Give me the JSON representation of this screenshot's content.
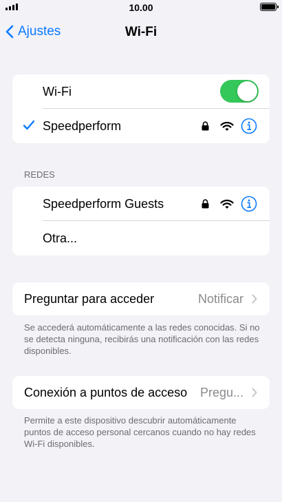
{
  "status_bar": {
    "time": "10.00"
  },
  "nav": {
    "back_label": "Ajustes",
    "title": "Wi-Fi"
  },
  "wifi_group": {
    "toggle_label": "Wi-Fi",
    "toggle_on": true,
    "connected_network": "Speedperform"
  },
  "networks": {
    "header": "REDES",
    "items": [
      {
        "label": "Speedperform Guests"
      },
      {
        "label": "Otra..."
      }
    ]
  },
  "ask_to_join": {
    "label": "Preguntar para acceder",
    "value": "Notificar",
    "footnote": "Se accederá automáticamente a las redes conocidas. Si no se detecta ninguna, recibirás una notificación con las redes disponibles."
  },
  "hotspot": {
    "label": "Conexión a puntos de acceso",
    "value": "Pregu...",
    "footnote": "Permite a este dispositivo descubrir automáticamente puntos de acceso personal cercanos cuando no hay redes Wi-Fi disponibles."
  },
  "colors": {
    "accent": "#0a7aff",
    "toggle_on": "#34c759",
    "background": "#f2f2f7"
  },
  "icons": [
    "signal-icon",
    "battery-icon",
    "chevron-left-icon",
    "checkmark-icon",
    "lock-icon",
    "wifi-icon",
    "info-icon",
    "chevron-right-icon"
  ]
}
